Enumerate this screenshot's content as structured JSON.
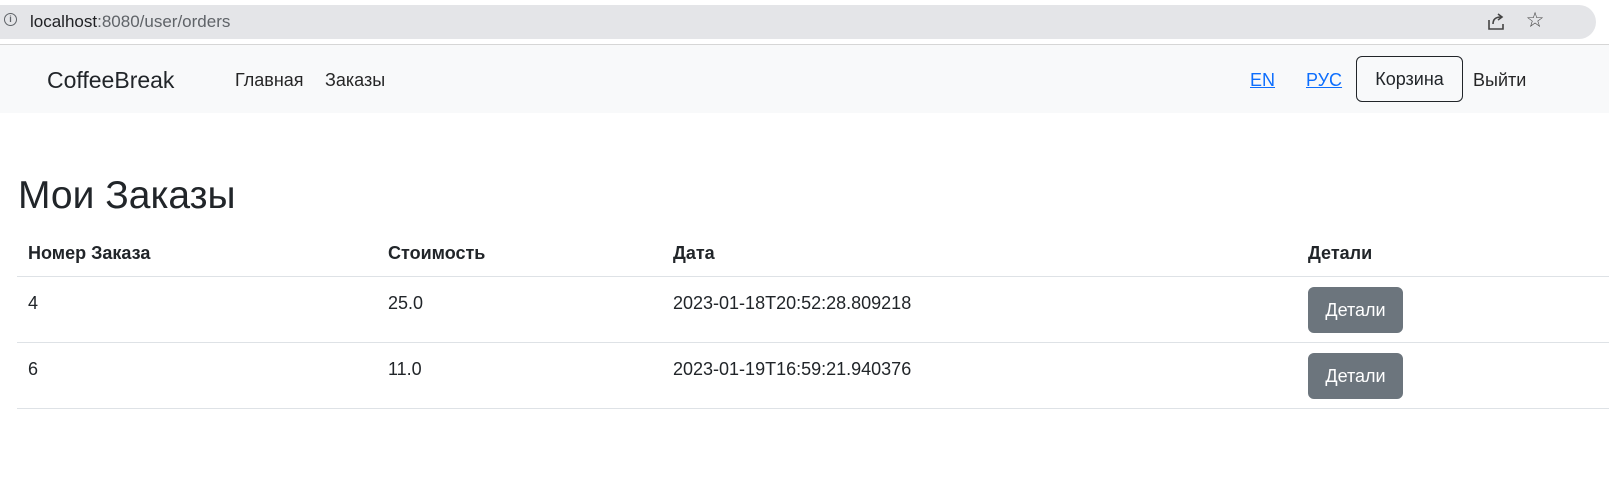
{
  "browser": {
    "url_host": "localhost",
    "url_path": ":8080/user/orders",
    "icons": [
      "info-icon",
      "share-icon",
      "star-icon"
    ]
  },
  "navbar": {
    "brand": "CoffeeBreak",
    "links": [
      "Главная",
      "Заказы"
    ],
    "lang_en": "EN",
    "lang_ru": "РУС",
    "cart_label": "Корзина",
    "logout_label": "Выйти"
  },
  "main": {
    "title": "Мои Заказы",
    "table": {
      "headers": [
        "Номер Заказа",
        "Стоимость",
        "Дата",
        "Детали"
      ],
      "rows": [
        {
          "order_number": "4",
          "cost": "25.0",
          "date": "2023-01-18T20:52:28.809218",
          "details_label": "Детали"
        },
        {
          "order_number": "6",
          "cost": "11.0",
          "date": "2023-01-19T16:59:21.940376",
          "details_label": "Детали"
        }
      ]
    }
  },
  "colors": {
    "navbar_bg": "#f8f9fa",
    "link_blue": "#0d6efd",
    "secondary_button": "#6c757d",
    "text": "#212529"
  }
}
